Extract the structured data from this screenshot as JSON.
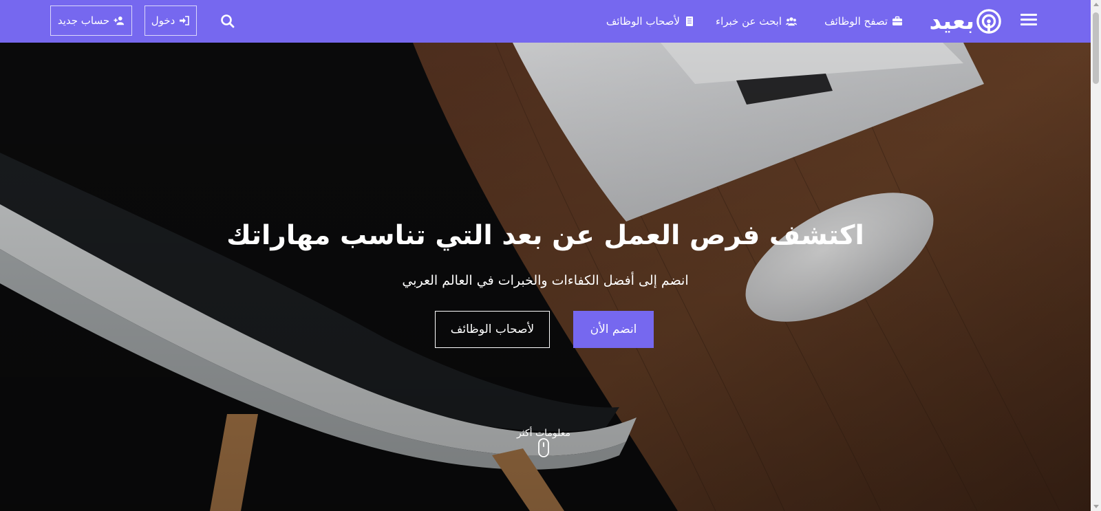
{
  "brand": {
    "name": "بعيد"
  },
  "nav": {
    "links": [
      {
        "label": "تصفح الوظائف",
        "icon": "briefcase-icon"
      },
      {
        "label": "ابحث عن خبراء",
        "icon": "users-icon"
      },
      {
        "label": "لأصحاب الوظائف",
        "icon": "document-icon"
      }
    ],
    "search_icon": "search-icon",
    "login_label": "دخول",
    "signup_label": "حساب جديد"
  },
  "hero": {
    "title": "اكتشف فرص العمل عن بعد التي تناسب مهاراتك",
    "subtitle": "انضم إلى أفضل الكفاءات والخبرات في العالم العربي",
    "join_label": "انضم الأن",
    "owners_label": "لأصحاب الوظائف",
    "more_info_label": "معلومات أكثر"
  },
  "colors": {
    "accent": "#7668ef",
    "text_on_accent": "#ffffff"
  }
}
